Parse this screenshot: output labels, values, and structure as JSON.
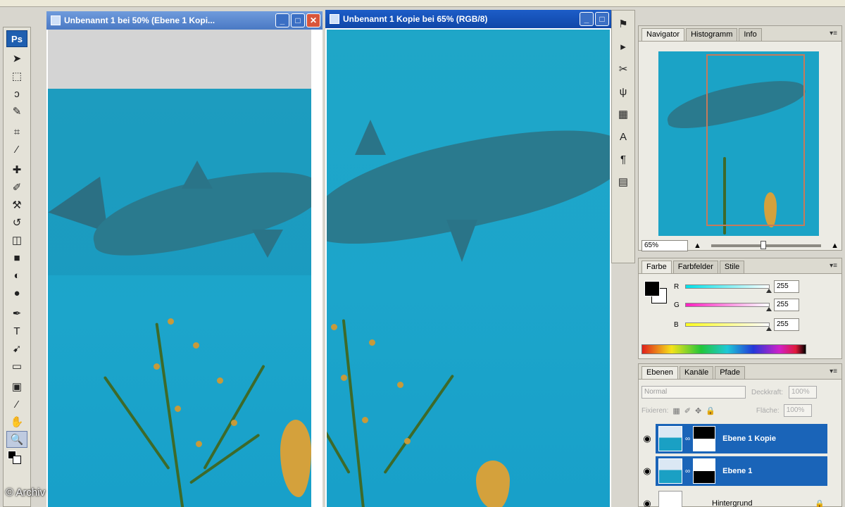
{
  "app": {
    "logo": "Ps"
  },
  "tools": {
    "items": [
      "move-tool",
      "marquee-tool",
      "lasso-tool",
      "quick-select-tool",
      "crop-tool",
      "eyedropper-tool",
      "healing-tool",
      "brush-tool",
      "stamp-tool",
      "history-brush-tool",
      "eraser-tool",
      "gradient-tool",
      "blur-tool",
      "dodge-tool",
      "pen-tool",
      "type-tool",
      "path-select-tool",
      "shape-tool",
      "notes-tool",
      "eyedropper2-tool",
      "hand-tool",
      "zoom-tool"
    ],
    "glyphs": [
      "➤",
      "⬚",
      "ↄ",
      "✎",
      "⌗",
      "⁄",
      "✚",
      "✐",
      "⚒",
      "↺",
      "◫",
      "■",
      "◐",
      "●",
      "✒",
      "T",
      "➹",
      "▭",
      "▣",
      "⁄",
      "✋",
      "🔍"
    ]
  },
  "doc1": {
    "title": "Unbenannt 1 bei 50% (Ebene 1 Kopi...",
    "min": "_",
    "max": "□",
    "close": "✕"
  },
  "doc2": {
    "title": "Unbenannt 1 Kopie bei 65% (RGB/8)",
    "min": "_",
    "max": "□"
  },
  "navigator": {
    "tabs": [
      "Navigator",
      "Histogramm",
      "Info"
    ],
    "zoom": "65%"
  },
  "color": {
    "tabs": [
      "Farbe",
      "Farbfelder",
      "Stile"
    ],
    "channels": [
      {
        "label": "R",
        "value": "255",
        "gradient": "linear-gradient(90deg,#00e0e8,#ffffff)"
      },
      {
        "label": "G",
        "value": "255",
        "gradient": "linear-gradient(90deg,#ff20c0,#ffffff)"
      },
      {
        "label": "B",
        "value": "255",
        "gradient": "linear-gradient(90deg,#ffff20,#ffffff)"
      }
    ]
  },
  "layers": {
    "tabs": [
      "Ebenen",
      "Kanäle",
      "Pfade"
    ],
    "blend_mode": "Normal",
    "opacity_label": "Deckkraft:",
    "opacity": "100%",
    "lock_label": "Fixieren:",
    "fill_label": "Fläche:",
    "fill": "100%",
    "items": [
      {
        "name": "Ebene 1 Kopie",
        "selected": true
      },
      {
        "name": "Ebene 1",
        "selected": true
      },
      {
        "name": "Hintergrund",
        "selected": false
      }
    ]
  },
  "watermark": "© Archiv"
}
